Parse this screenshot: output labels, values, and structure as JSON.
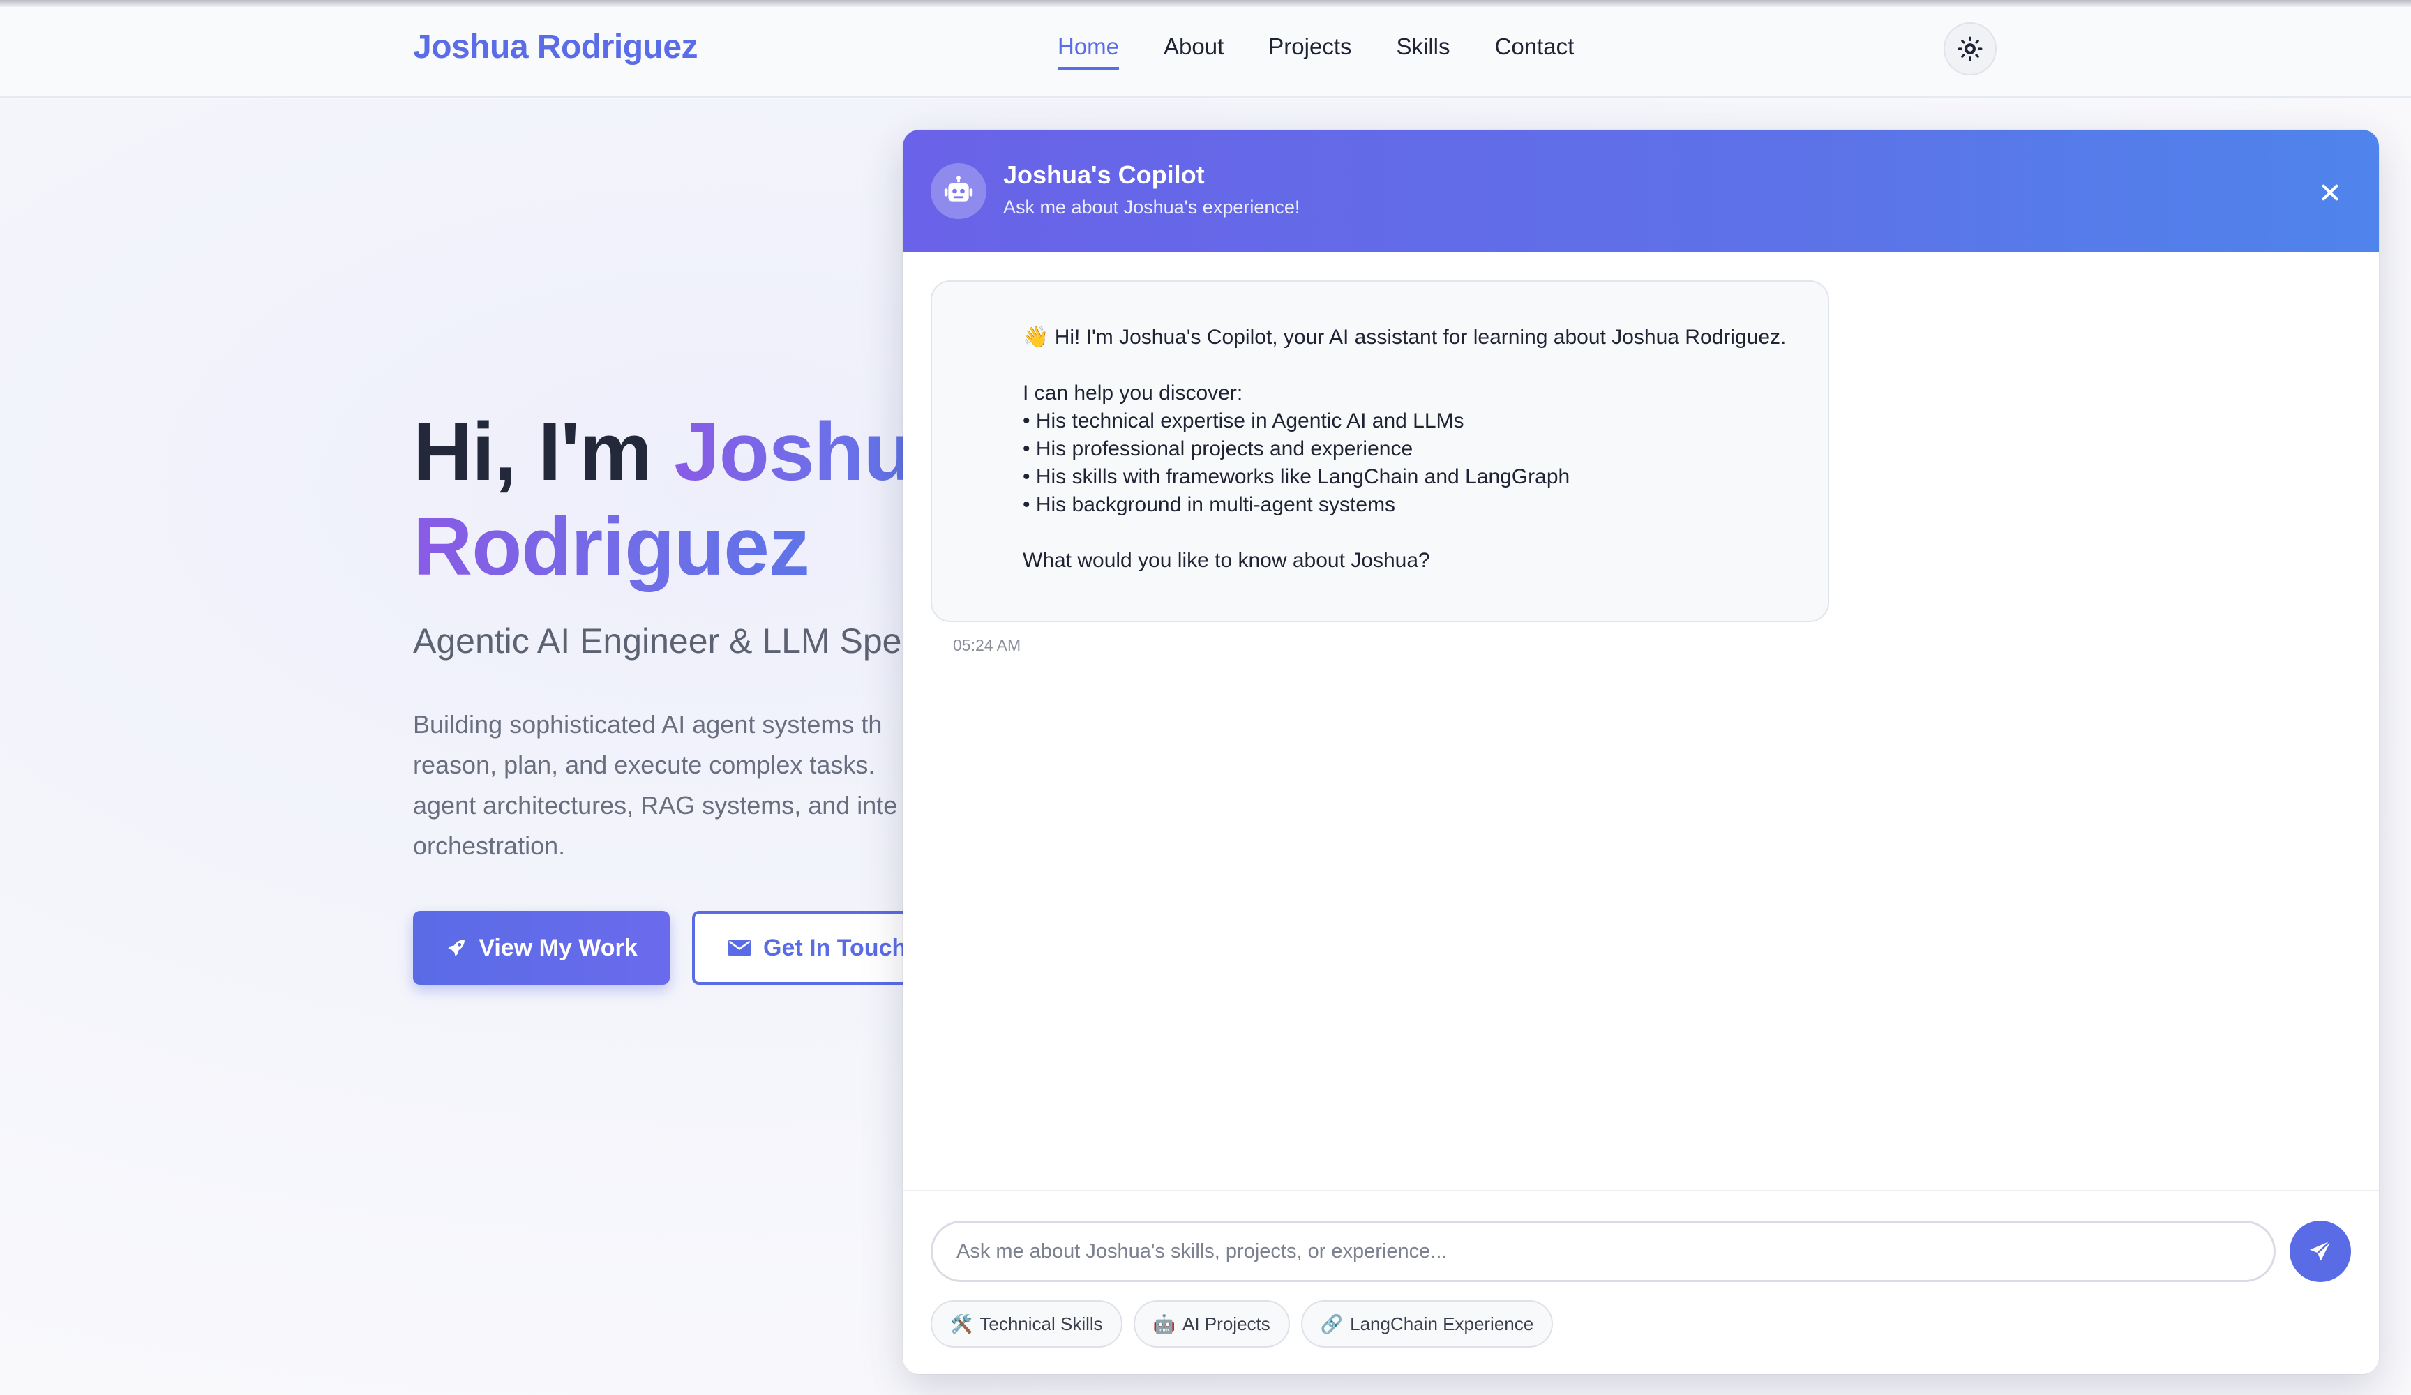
{
  "navbar": {
    "brand": "Joshua Rodriguez",
    "links": [
      {
        "label": "Home",
        "active": true
      },
      {
        "label": "About",
        "active": false
      },
      {
        "label": "Projects",
        "active": false
      },
      {
        "label": "Skills",
        "active": false
      },
      {
        "label": "Contact",
        "active": false
      }
    ],
    "theme_toggle_icon": "sun-icon"
  },
  "hero": {
    "greeting": "Hi, I'm ",
    "name_partial": "Joshu",
    "name_line2": "Rodriguez",
    "subtitle": "Agentic AI Engineer & LLM Spe",
    "description_lines": [
      "Building sophisticated AI agent systems th",
      "reason, plan, and execute complex tasks. ",
      "agent architectures, RAG systems, and inte",
      "orchestration."
    ],
    "primary_button": {
      "label": "View My Work",
      "icon": "rocket-icon"
    },
    "secondary_button": {
      "label": "Get In Touch",
      "icon": "envelope-icon"
    }
  },
  "chat": {
    "title": "Joshua's Copilot",
    "subtitle": "Ask me about Joshua's experience!",
    "avatar_icon": "robot-icon",
    "close_icon": "close-icon",
    "message": {
      "emoji": "👋",
      "intro": " Hi! I'm Joshua's Copilot, your AI assistant for learning about Joshua Rodriguez.",
      "lead": "I can help you discover:",
      "bullets": [
        "• His technical expertise in Agentic AI and LLMs",
        "• His professional projects and experience",
        "• His skills with frameworks like LangChain and LangGraph",
        "• His background in multi-agent systems"
      ],
      "question": "What would you like to know about Joshua?",
      "time": "05:24 AM"
    },
    "input": {
      "value": "",
      "placeholder": "Ask me about Joshua's skills, projects, or experience..."
    },
    "send_icon": "paper-plane-icon",
    "suggestions": [
      {
        "emoji": "🛠️",
        "label": "Technical Skills"
      },
      {
        "emoji": "🤖",
        "label": "AI Projects"
      },
      {
        "emoji": "🔗",
        "label": "LangChain Experience"
      }
    ]
  },
  "colors": {
    "accent": "#5a6be6",
    "gradient_purple": "#8a5be6",
    "header_gradient_start": "#6a62e8",
    "header_gradient_end": "#4f84ec"
  }
}
